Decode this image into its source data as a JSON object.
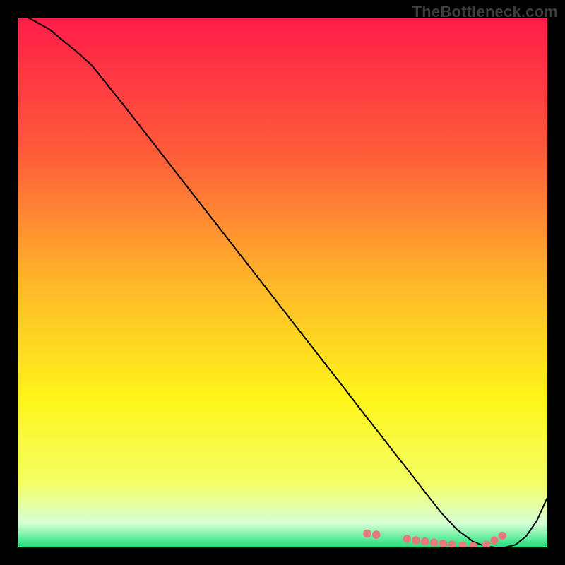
{
  "watermark": "TheBottleneck.com",
  "chart_data": {
    "type": "line",
    "title": "",
    "xlabel": "",
    "ylabel": "",
    "xlim": [
      0,
      100
    ],
    "ylim": [
      0,
      100
    ],
    "grid": false,
    "legend": false,
    "background_gradient": {
      "stops": [
        {
          "offset": 0.0,
          "color": "#ff1d4a"
        },
        {
          "offset": 0.25,
          "color": "#ff5a3a"
        },
        {
          "offset": 0.5,
          "color": "#ffb62a"
        },
        {
          "offset": 0.72,
          "color": "#fff51a"
        },
        {
          "offset": 0.88,
          "color": "#f4ff66"
        },
        {
          "offset": 0.955,
          "color": "#d6ffd6"
        },
        {
          "offset": 1.0,
          "color": "#1be07a"
        }
      ]
    },
    "series": [
      {
        "name": "curve",
        "color": "#000000",
        "x": [
          2,
          6,
          9,
          11,
          14,
          20,
          26,
          32,
          38,
          44,
          50,
          56,
          62,
          65,
          68,
          71,
          74,
          77,
          80,
          83,
          86,
          88,
          90,
          92,
          94,
          96,
          98,
          100
        ],
        "y": [
          100,
          97.8,
          95.3,
          93.7,
          91.0,
          83.5,
          75.8,
          68.1,
          60.4,
          52.7,
          45.0,
          37.3,
          29.6,
          25.7,
          21.9,
          18.0,
          14.2,
          10.3,
          6.5,
          3.3,
          1.1,
          0.3,
          0.0,
          0.0,
          0.5,
          2.1,
          5.0,
          9.4
        ]
      }
    ],
    "markers": {
      "name": "dots",
      "color": "#e47a7a",
      "radius": 5.8,
      "x": [
        66.0,
        67.7,
        73.5,
        75.2,
        76.9,
        78.6,
        80.3,
        82.0,
        84.0,
        86.0,
        88.5,
        90.0,
        91.5
      ],
      "y": [
        2.6,
        2.4,
        1.6,
        1.3,
        1.1,
        0.9,
        0.7,
        0.5,
        0.35,
        0.25,
        0.5,
        1.3,
        2.2
      ]
    }
  }
}
